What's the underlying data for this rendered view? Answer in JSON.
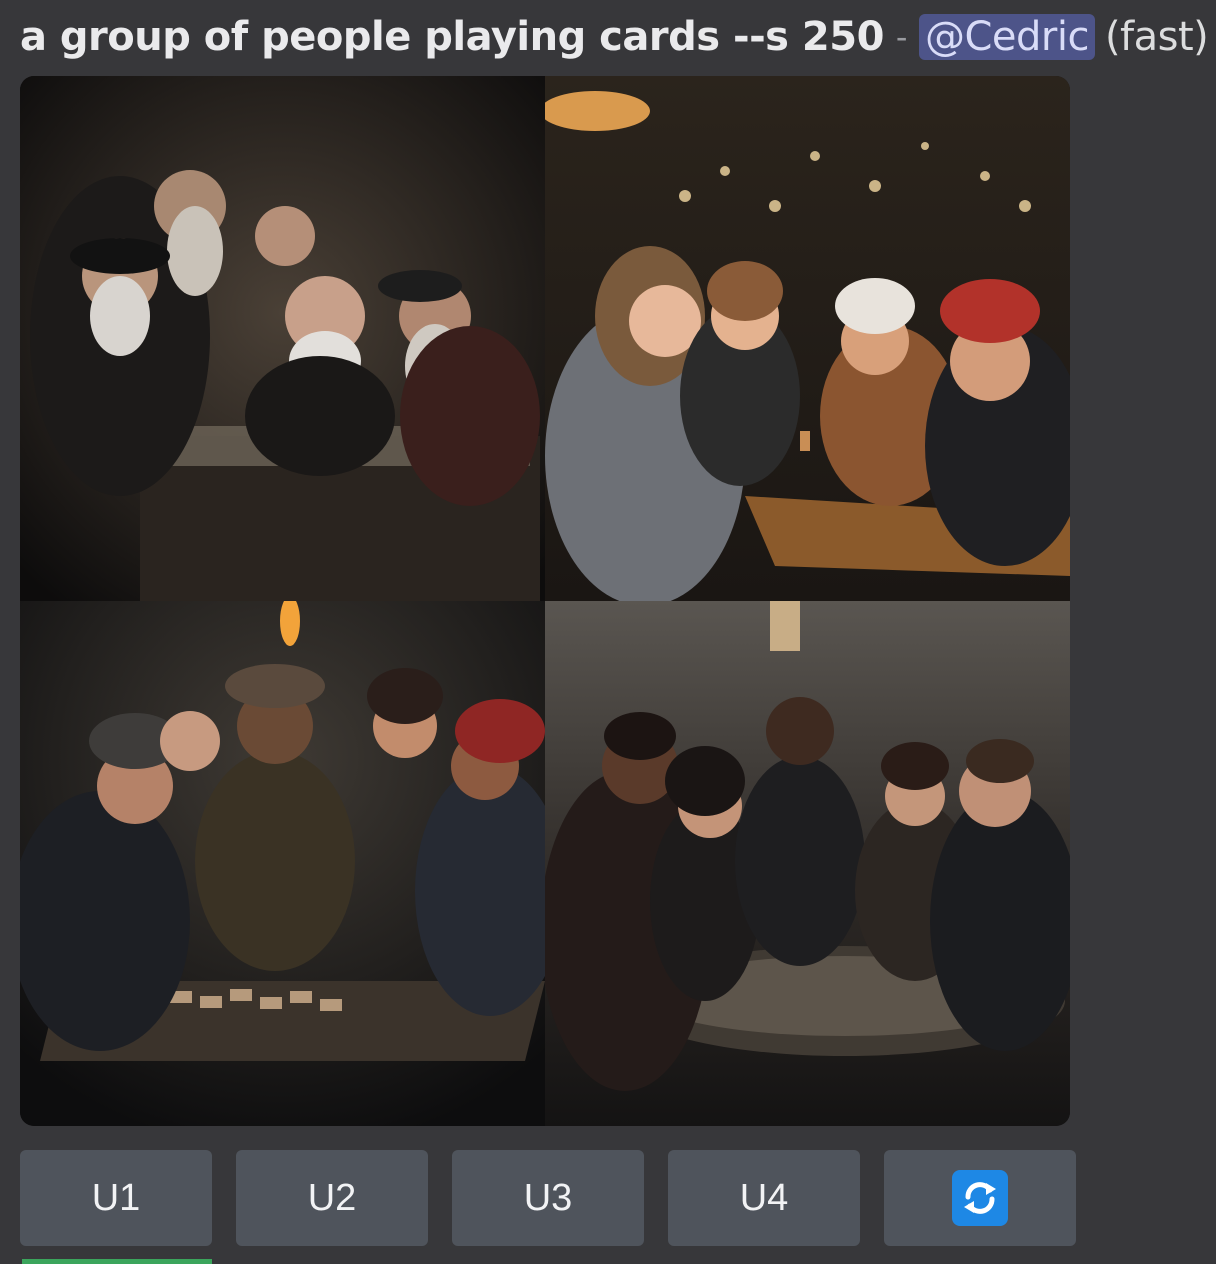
{
  "message": {
    "prompt": "a group of people playing cards --s 250",
    "separator": "-",
    "mention": "@Cedric",
    "speed": "(fast)"
  },
  "image_grid": {
    "tiles": [
      {
        "scene": "medieval-bearded-men-playing-cards"
      },
      {
        "scene": "friends-laughing-at-cafe-table"
      },
      {
        "scene": "torchlit-fantasy-card-game"
      },
      {
        "scene": "dark-tavern-card-game"
      }
    ]
  },
  "buttons": {
    "u1": "U1",
    "u2": "U2",
    "u3": "U3",
    "u4": "U4",
    "reroll_icon": "reroll-icon"
  },
  "colors": {
    "background": "#37373a",
    "mention_bg": "#4d5489",
    "button_bg": "#4f545c",
    "reroll_icon": "#1e88e5"
  }
}
